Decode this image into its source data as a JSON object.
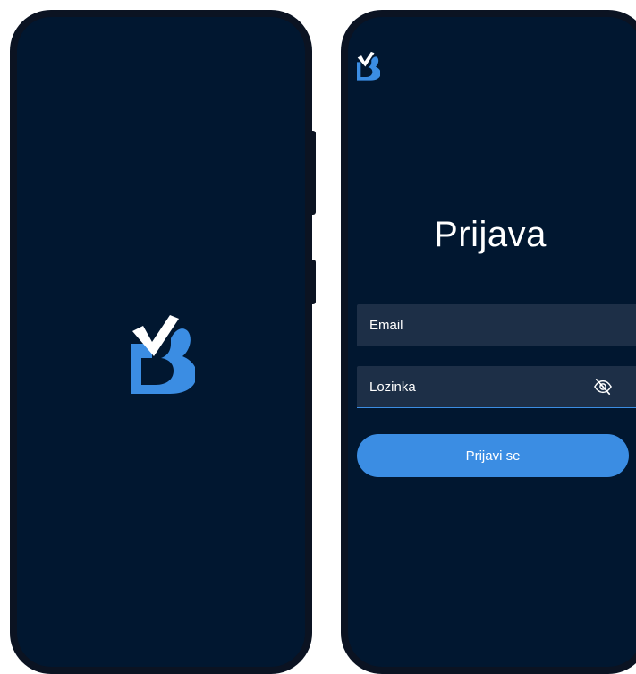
{
  "splash": {
    "logo_icon": "brand-b-check-logo"
  },
  "login": {
    "logo_icon": "brand-b-check-logo",
    "title": "Prijava",
    "email_label": "Email",
    "password_label": "Lozinka",
    "visibility_icon": "eye-off-icon",
    "submit_label": "Prijavi se"
  },
  "theme": {
    "background": "#011730",
    "frame": "#0b1322",
    "field_background": "#1d2f47",
    "accent": "#3b8de3",
    "text": "#ffffff"
  }
}
